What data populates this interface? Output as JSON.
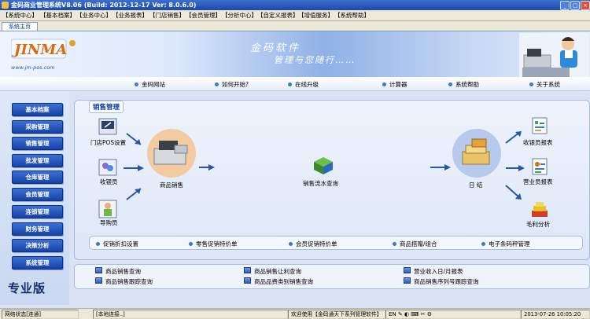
{
  "window": {
    "title": "金码商业管理系统V8.06  (Build: 2012-12-17  Ver: 8.0.6.0)",
    "controls": [
      "_",
      "□",
      "×"
    ]
  },
  "menu": [
    "【系统中心】",
    "【基本档案】",
    "【业务中心】",
    "【业务报表】",
    "【门店销售】",
    "【会员管理】",
    "【分析中心】",
    "【自定义报表】",
    "【增值服务】",
    "【系统帮助】"
  ],
  "tab": {
    "label": "系统主页"
  },
  "banner": {
    "logo_text": "JINMA",
    "url": "www.jm-pos.com",
    "slogan1": "金码软件",
    "slogan2": "管理与您随行……"
  },
  "links": [
    "金码网站",
    "如何开始?",
    "在线升级",
    "计算器",
    "系统帮助",
    "关于系统"
  ],
  "sidebar": {
    "items": [
      "基本档案",
      "采购管理",
      "销售管理",
      "批发管理",
      "仓库管理",
      "会员管理",
      "连锁管理",
      "财务管理",
      "决策分析",
      "系统管理"
    ],
    "edition": "专业版"
  },
  "main": {
    "header": "销售管理",
    "nodes": {
      "pos_settings": "门店POS设置",
      "cashier": "收银员",
      "guide": "导购员",
      "sales": "商品销售",
      "flow_query": "销售流水查询",
      "daily": "日  结",
      "cashier_report": "收银员报表",
      "business_report": "营业员报表",
      "gross_profit": "毛利分析"
    },
    "bottom_links": [
      "促销折扣设置",
      "零售促销特价单",
      "会员促销特价单",
      "商品搭赠/组合",
      "电子条码秤管理"
    ]
  },
  "quick_links": [
    "商品销售查询",
    "商品销售让利查询",
    "营业收入日/月报表",
    "商品销售跟踪查询",
    "商品品费类别销售查询",
    "商品销售序列号跟踪查询"
  ],
  "status": {
    "network_label": "网络状态",
    "network_value": "[连通]",
    "connection": "[本地连接..]",
    "welcome": "欢迎使用【金码通天下系列管理软件】",
    "datetime": "2013-07-26 10:05:20"
  }
}
